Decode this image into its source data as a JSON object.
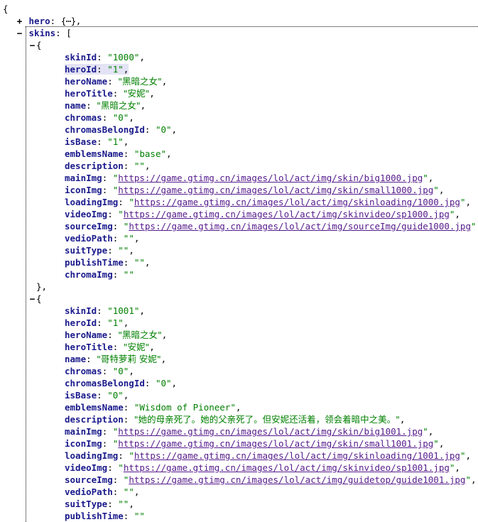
{
  "viewer": {
    "name": "json-tree-viewer",
    "root_open_brace": "{",
    "expand_icon": "+",
    "collapse_icon": "−",
    "collapsed_object_glyph": "{⋯}",
    "colors": {
      "key": "#1a1a8c",
      "string": "#008000",
      "link": "#551a8b",
      "selection": "#e3e3f5",
      "background": "#ffffff",
      "punctuation": "#000000"
    }
  },
  "tree": {
    "hero": {
      "key": "hero",
      "toggle": "+",
      "collapsed_value": "{⋯}",
      "trailing": ","
    },
    "skins": {
      "key": "skins",
      "toggle": "−",
      "open_bracket": "["
    }
  },
  "items": [
    {
      "toggle": "−",
      "open_brace": "{",
      "close_brace": "},",
      "fields": [
        {
          "key": "skinId",
          "value": "1000",
          "type": "string",
          "selected": false
        },
        {
          "key": "heroId",
          "value": "1",
          "type": "string",
          "selected": true
        },
        {
          "key": "heroName",
          "value": "黑暗之女",
          "type": "string",
          "cjk": true
        },
        {
          "key": "heroTitle",
          "value": "安妮",
          "type": "string",
          "cjk": true
        },
        {
          "key": "name",
          "value": "黑暗之女",
          "type": "string",
          "cjk": true
        },
        {
          "key": "chromas",
          "value": "0",
          "type": "string"
        },
        {
          "key": "chromasBelongId",
          "value": "0",
          "type": "string"
        },
        {
          "key": "isBase",
          "value": "1",
          "type": "string"
        },
        {
          "key": "emblemsName",
          "value": "base",
          "type": "string"
        },
        {
          "key": "description",
          "value": "",
          "type": "string"
        },
        {
          "key": "mainImg",
          "value": "https://game.gtimg.cn/images/lol/act/img/skin/big1000.jpg",
          "type": "link"
        },
        {
          "key": "iconImg",
          "value": "https://game.gtimg.cn/images/lol/act/img/skin/small1000.jpg",
          "type": "link"
        },
        {
          "key": "loadingImg",
          "value": "https://game.gtimg.cn/images/lol/act/img/skinloading/1000.jpg",
          "type": "link"
        },
        {
          "key": "videoImg",
          "value": "https://game.gtimg.cn/images/lol/act/img/skinvideo/sp1000.jpg",
          "type": "link"
        },
        {
          "key": "sourceImg",
          "value": "https://game.gtimg.cn/images/lol/act/img/sourceImg/guide1000.jpg",
          "type": "link"
        },
        {
          "key": "vedioPath",
          "value": "",
          "type": "string"
        },
        {
          "key": "suitType",
          "value": "",
          "type": "string"
        },
        {
          "key": "publishTime",
          "value": "",
          "type": "string"
        },
        {
          "key": "chromaImg",
          "value": "",
          "type": "string",
          "last": true
        }
      ]
    },
    {
      "toggle": "−",
      "open_brace": "{",
      "close_brace": "",
      "fields": [
        {
          "key": "skinId",
          "value": "1001",
          "type": "string"
        },
        {
          "key": "heroId",
          "value": "1",
          "type": "string"
        },
        {
          "key": "heroName",
          "value": "黑暗之女",
          "type": "string",
          "cjk": true
        },
        {
          "key": "heroTitle",
          "value": "安妮",
          "type": "string",
          "cjk": true
        },
        {
          "key": "name",
          "value": "哥特萝莉 安妮",
          "type": "string",
          "cjk": true
        },
        {
          "key": "chromas",
          "value": "0",
          "type": "string"
        },
        {
          "key": "chromasBelongId",
          "value": "0",
          "type": "string"
        },
        {
          "key": "isBase",
          "value": "0",
          "type": "string"
        },
        {
          "key": "emblemsName",
          "value": "Wisdom of Pioneer",
          "type": "string"
        },
        {
          "key": "description",
          "value": "她的母亲死了。她的父亲死了。但安妮还活着，领会着暗中之美。",
          "type": "string",
          "cjk": true
        },
        {
          "key": "mainImg",
          "value": "https://game.gtimg.cn/images/lol/act/img/skin/big1001.jpg",
          "type": "link"
        },
        {
          "key": "iconImg",
          "value": "https://game.gtimg.cn/images/lol/act/img/skin/small1001.jpg",
          "type": "link"
        },
        {
          "key": "loadingImg",
          "value": "https://game.gtimg.cn/images/lol/act/img/skinloading/1001.jpg",
          "type": "link"
        },
        {
          "key": "videoImg",
          "value": "https://game.gtimg.cn/images/lol/act/img/skinvideo/sp1001.jpg",
          "type": "link"
        },
        {
          "key": "sourceImg",
          "value": "https://game.gtimg.cn/images/lol/act/img/guidetop/guide1001.jpg",
          "type": "link"
        },
        {
          "key": "vedioPath",
          "value": "",
          "type": "string"
        },
        {
          "key": "suitType",
          "value": "",
          "type": "string"
        },
        {
          "key": "publishTime",
          "value": "",
          "type": "string",
          "last": true
        }
      ]
    }
  ]
}
